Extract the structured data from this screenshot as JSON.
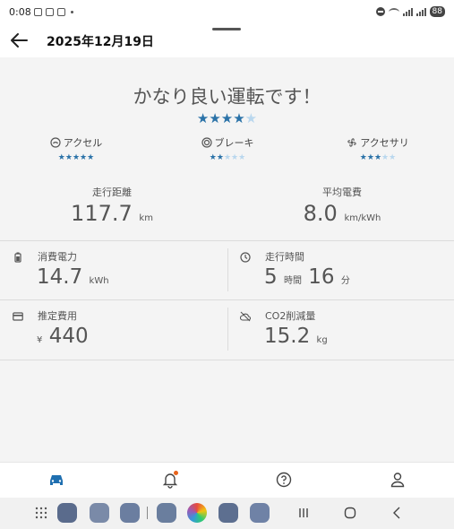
{
  "status_bar": {
    "time": "0:08",
    "battery": "88"
  },
  "header": {
    "title": "2025年12月19日",
    "back_icon": "arrow-left-icon"
  },
  "rating": {
    "headline": "かなり良い運転です！",
    "overall_stars": 4,
    "max_stars": 5
  },
  "categories": [
    {
      "label": "アクセル",
      "icon": "accelerator-icon",
      "stars": 5
    },
    {
      "label": "ブレーキ",
      "icon": "brake-icon",
      "stars": 2
    },
    {
      "label": "アクセサリ",
      "icon": "fan-icon",
      "stars": 3
    }
  ],
  "summary": {
    "distance": {
      "label": "走行距離",
      "value": "117.7",
      "unit": "km"
    },
    "efficiency": {
      "label": "平均電費",
      "value": "8.0",
      "unit": "km/kWh"
    }
  },
  "metrics": {
    "energy": {
      "label": "消費電力",
      "value": "14.7",
      "unit": "kWh",
      "icon": "battery-icon"
    },
    "time": {
      "label": "走行時間",
      "hours": "5",
      "hours_unit": "時間",
      "minutes": "16",
      "minutes_unit": "分",
      "icon": "clock-icon"
    },
    "cost": {
      "label": "推定費用",
      "currency": "¥",
      "value": "440",
      "icon": "card-icon"
    },
    "co2": {
      "label": "CO2削減量",
      "value": "15.2",
      "unit": "kg",
      "icon": "cloud-off-icon"
    }
  },
  "bottom_nav": [
    {
      "icon": "car-icon",
      "active": true
    },
    {
      "icon": "bell-icon",
      "active": false,
      "has_badge": true
    },
    {
      "icon": "help-icon",
      "active": false
    },
    {
      "icon": "person-icon",
      "active": false
    }
  ],
  "colors": {
    "accent": "#2a72a8",
    "star_off": "#b9d7ee",
    "badge": "#e8641c",
    "panel_bg": "#f4f4f4"
  }
}
